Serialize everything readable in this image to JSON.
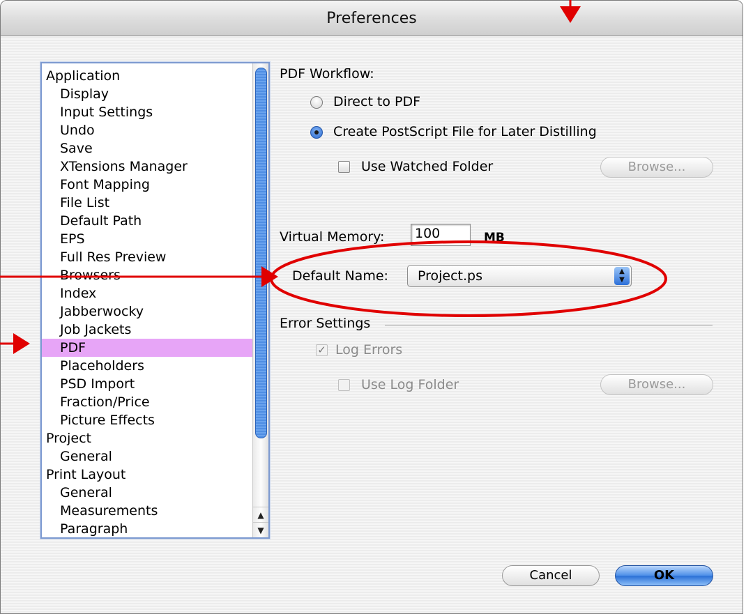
{
  "window": {
    "title": "Preferences"
  },
  "categories": [
    {
      "label": "Application",
      "level": 0
    },
    {
      "label": "Display",
      "level": 1
    },
    {
      "label": "Input Settings",
      "level": 1
    },
    {
      "label": "Undo",
      "level": 1
    },
    {
      "label": "Save",
      "level": 1
    },
    {
      "label": "XTensions Manager",
      "level": 1
    },
    {
      "label": "Font Mapping",
      "level": 1
    },
    {
      "label": "File List",
      "level": 1
    },
    {
      "label": "Default Path",
      "level": 1
    },
    {
      "label": "EPS",
      "level": 1
    },
    {
      "label": "Full Res Preview",
      "level": 1
    },
    {
      "label": "Browsers",
      "level": 1
    },
    {
      "label": "Index",
      "level": 1
    },
    {
      "label": "Jabberwocky",
      "level": 1
    },
    {
      "label": "Job Jackets",
      "level": 1
    },
    {
      "label": "PDF",
      "level": 1,
      "selected": true
    },
    {
      "label": "Placeholders",
      "level": 1
    },
    {
      "label": "PSD Import",
      "level": 1
    },
    {
      "label": "Fraction/Price",
      "level": 1
    },
    {
      "label": "Picture Effects",
      "level": 1
    },
    {
      "label": "Project",
      "level": 0
    },
    {
      "label": "General",
      "level": 1
    },
    {
      "label": "Print Layout",
      "level": 0
    },
    {
      "label": "General",
      "level": 1
    },
    {
      "label": "Measurements",
      "level": 1
    },
    {
      "label": "Paragraph",
      "level": 1
    }
  ],
  "pdf": {
    "workflow_label": "PDF Workflow:",
    "direct_label": "Direct to PDF",
    "postscript_label": "Create PostScript File for Later Distilling",
    "watched_folder_label": "Use Watched Folder",
    "browse_label": "Browse...",
    "virtual_memory_label": "Virtual Memory:",
    "virtual_memory_value": "100",
    "virtual_memory_unit": "MB",
    "default_name_label": "Default Name:",
    "default_name_value": "Project.ps",
    "error_settings_label": "Error Settings",
    "log_errors_label": "Log Errors",
    "use_log_folder_label": "Use Log Folder",
    "browse2_label": "Browse..."
  },
  "buttons": {
    "cancel": "Cancel",
    "ok": "OK"
  },
  "colors": {
    "selection": "#e7a5f7",
    "annotation": "#e00000",
    "accent": "#2a6fd6"
  }
}
